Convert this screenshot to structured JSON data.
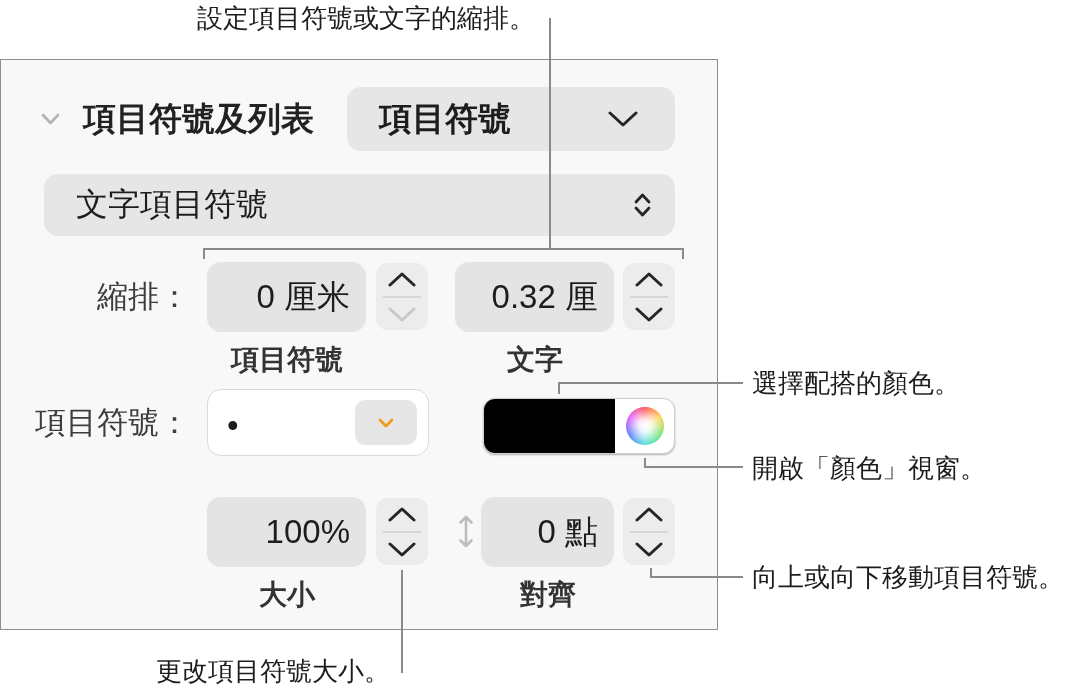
{
  "callouts": [
    {
      "text": "設定項目符號或文字的縮排。"
    },
    {
      "text": "選擇配搭的顏色。"
    },
    {
      "text": "開啟「顏色」視窗。"
    },
    {
      "text": "向上或向下移動項目符號。"
    },
    {
      "text": "更改項目符號大小。"
    }
  ],
  "panel": {
    "header": {
      "title": "項目符號及列表",
      "expanded": true,
      "popup": {
        "kind": "pulldown",
        "value": "項目符號"
      }
    },
    "style_popup": {
      "kind": "popup",
      "value": "文字項目符號"
    },
    "indent": {
      "label": "縮排：",
      "fields": [
        {
          "value": "0 厘米",
          "caption": "項目符號",
          "decrement_disabled": true
        },
        {
          "value": "0.32 厘",
          "caption": "文字",
          "decrement_disabled": false
        }
      ]
    },
    "bullet": {
      "label": "項目符號：",
      "value": "•",
      "color": "#000000"
    },
    "position": {
      "fields": [
        {
          "value": "100%",
          "caption": "大小",
          "decrement_disabled": false
        },
        {
          "value": "0 點",
          "caption": "對齊",
          "decrement_disabled": false
        }
      ]
    }
  }
}
